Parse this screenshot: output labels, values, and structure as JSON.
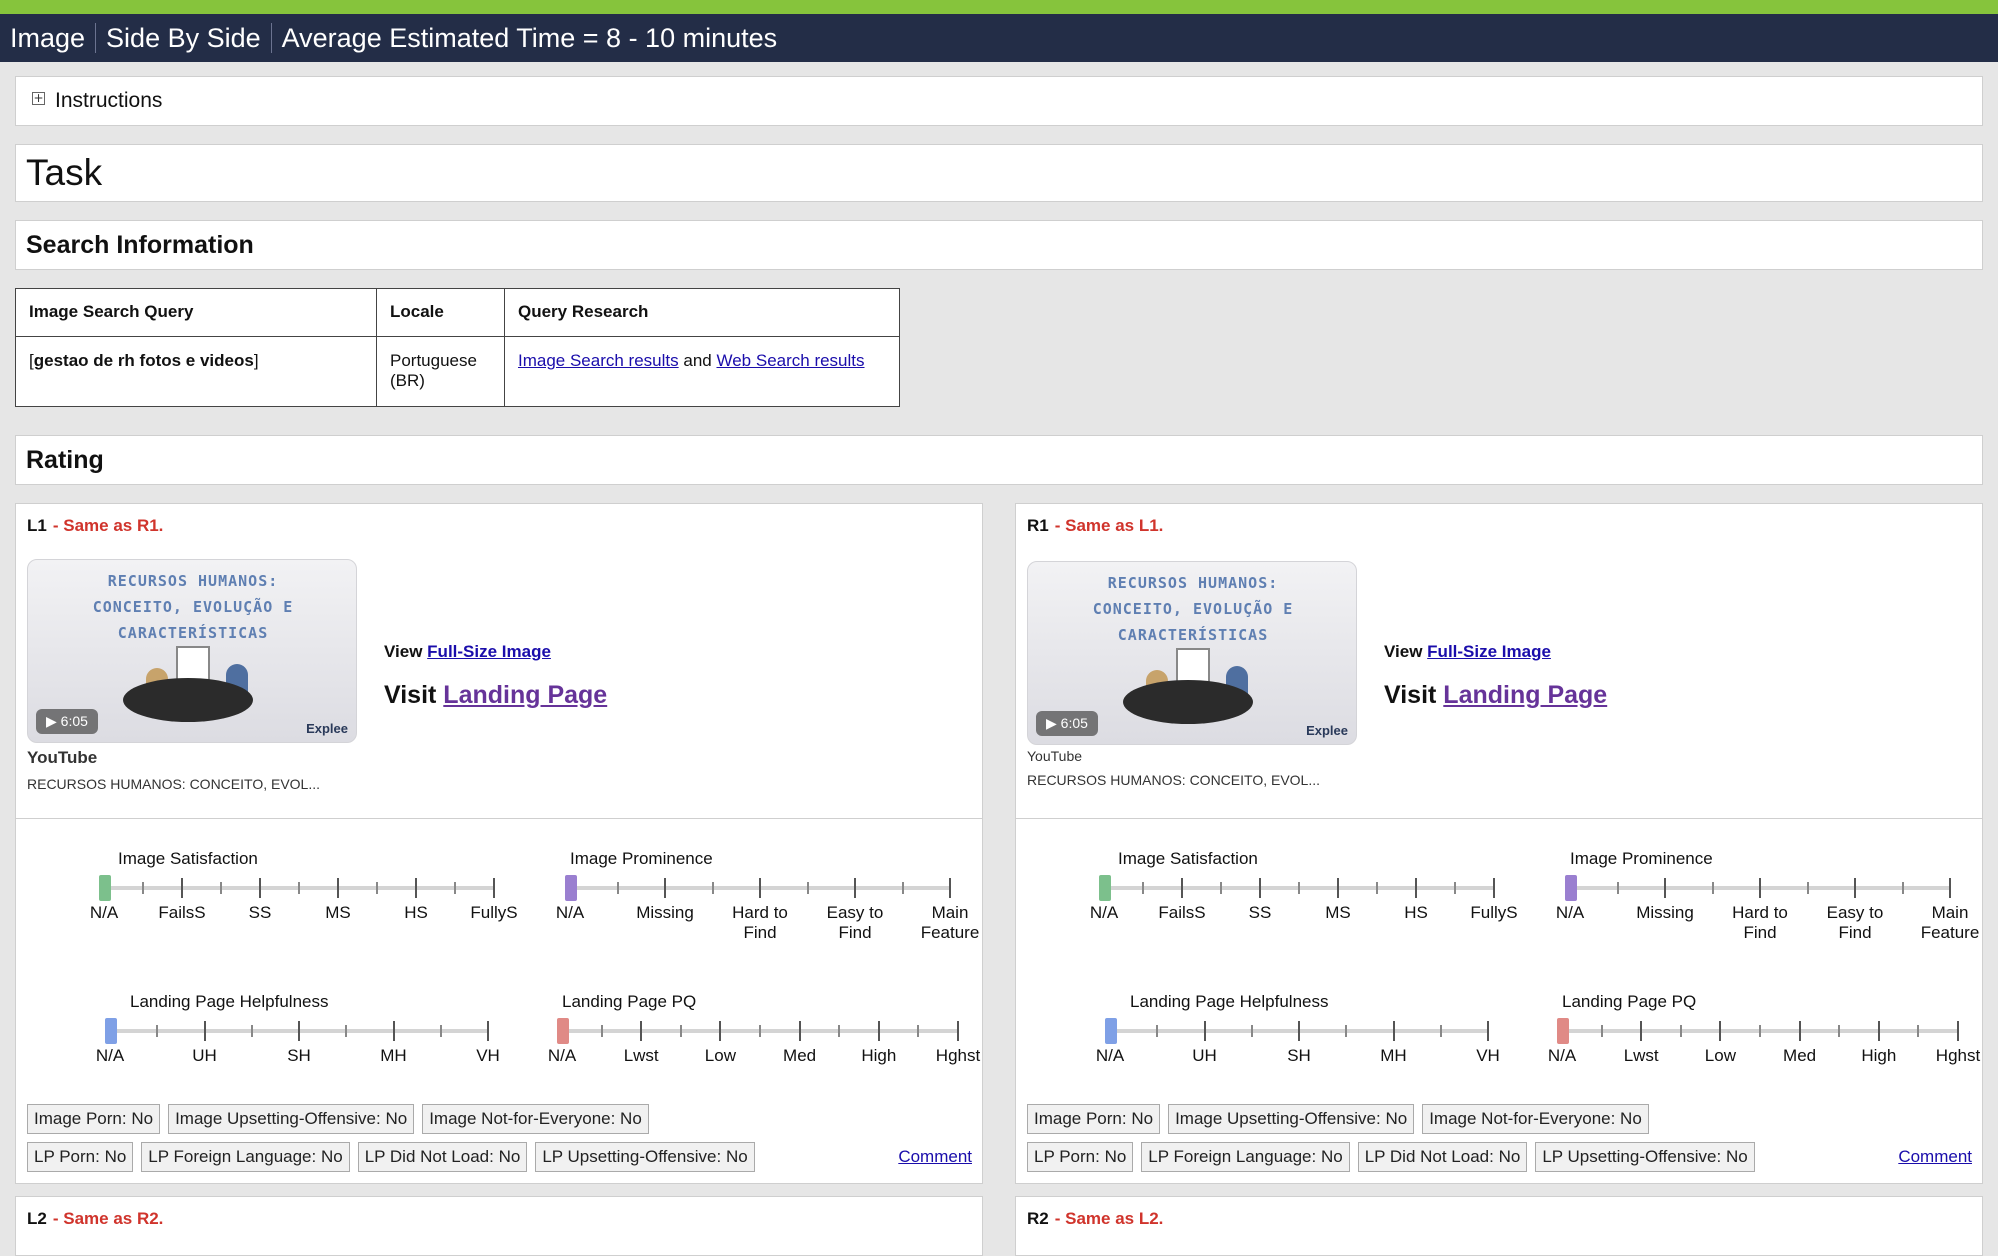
{
  "header": {
    "tabs": [
      "Image",
      "Side By Side",
      "Average Estimated Time = 8 - 10 minutes"
    ]
  },
  "instructions": {
    "label": "Instructions"
  },
  "task": {
    "title": "Task"
  },
  "search": {
    "title": "Search Information",
    "headers": [
      "Image Search Query",
      "Locale",
      "Query Research"
    ],
    "query": "gestao de rh fotos e videos",
    "locale": "Portuguese (BR)",
    "research_link1": "Image Search results",
    "research_and": "and",
    "research_link2": "Web Search results"
  },
  "rating": {
    "title": "Rating"
  },
  "cards": [
    {
      "id": "L1",
      "same": "- Same as R1.",
      "thumb_title": "RECURSOS HUMANOS: CONCEITO, EVOLUÇÃO E CARACTERÍSTICAS",
      "duration": "6:05",
      "brand": "Explee",
      "source": "YouTube",
      "caption": "RECURSOS HUMANOS: CONCEITO, EVOL...",
      "view": "View",
      "view_link": "Full-Size Image",
      "visit": "Visit",
      "visit_link": "Landing Page"
    },
    {
      "id": "R1",
      "same": "- Same as L1.",
      "thumb_title": "RECURSOS HUMANOS: CONCEITO, EVOLUÇÃO E CARACTERÍSTICAS",
      "duration": "6:05",
      "brand": "Explee",
      "source": "YouTube",
      "caption": "RECURSOS HUMANOS: CONCEITO, EVOL...",
      "view": "View",
      "view_link": "Full-Size Image",
      "visit": "Visit",
      "visit_link": "Landing Page"
    }
  ],
  "scales": {
    "satisfaction": {
      "label": "Image Satisfaction",
      "options": [
        "N/A",
        "FailsS",
        "SS",
        "MS",
        "HS",
        "FullyS"
      ],
      "value": "N/A",
      "color": "#7cc08c"
    },
    "prominence": {
      "label": "Image Prominence",
      "options": [
        "N/A",
        "Missing",
        "Hard to Find",
        "Easy to Find",
        "Main Feature"
      ],
      "value": "N/A",
      "color": "#9a7fd0"
    },
    "helpfulness": {
      "label": "Landing Page Helpfulness",
      "options": [
        "N/A",
        "UH",
        "SH",
        "MH",
        "VH"
      ],
      "value": "N/A",
      "color": "#7fa0e6"
    },
    "pq": {
      "label": "Landing Page PQ",
      "options": [
        "N/A",
        "Lwst",
        "Low",
        "Med",
        "High",
        "Hghst"
      ],
      "value": "N/A",
      "color": "#e08a86"
    }
  },
  "flags_row1": [
    "Image Porn: No",
    "Image Upsetting-Offensive: No",
    "Image Not-for-Everyone: No"
  ],
  "flags_row2": [
    "LP Porn: No",
    "LP Foreign Language: No",
    "LP Did Not Load: No",
    "LP Upsetting-Offensive: No"
  ],
  "comment": "Comment",
  "cards2": [
    {
      "id": "L2",
      "same": "- Same as R2."
    },
    {
      "id": "R2",
      "same": "- Same as L2."
    }
  ]
}
